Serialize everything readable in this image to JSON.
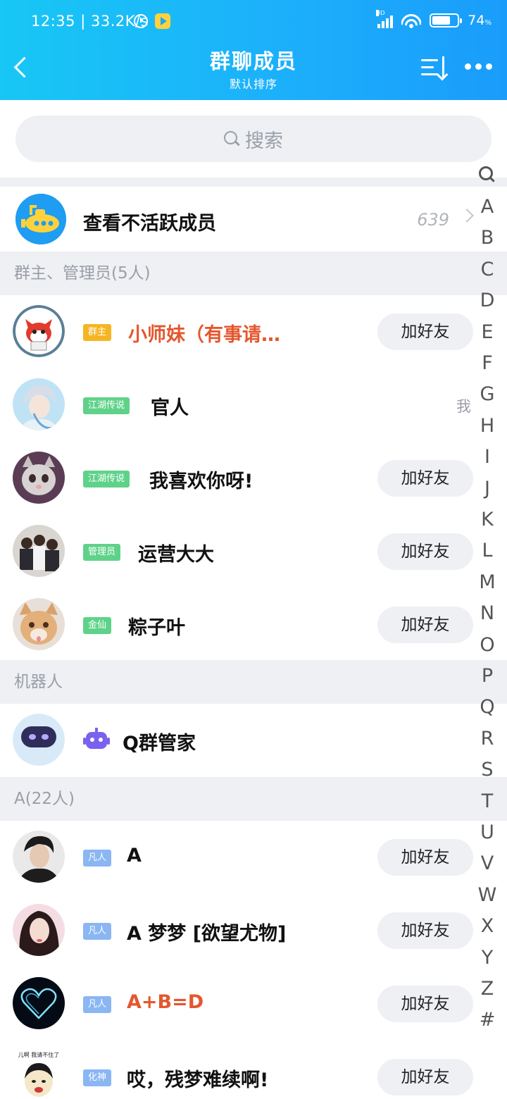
{
  "status_bar": {
    "time": "12:35",
    "network_speed": "33.2K/s",
    "hd_label": "HD",
    "battery_percent": "74",
    "battery_unit": "%",
    "battery_level": 0.74
  },
  "nav": {
    "title": "群聊成员",
    "subtitle": "默认排序"
  },
  "search": {
    "placeholder": "搜索"
  },
  "inactive": {
    "label": "查看不活跃成员",
    "count": "639"
  },
  "sections": {
    "admins_header": "群主、管理员(5人)",
    "robots_header": "机器人",
    "a_header": "A(22人)"
  },
  "admins": [
    {
      "badge": "群主",
      "badge_color": "#f5b523",
      "name": "小师妹（有事请…",
      "name_color": "#e4572e",
      "action": "加好友"
    },
    {
      "badge": "江湖传说",
      "badge_color": "#5fd28a",
      "name": "官人",
      "name_color": "#111111",
      "me_label": "我"
    },
    {
      "badge": "江湖传说",
      "badge_color": "#5fd28a",
      "name": "我喜欢你呀!",
      "name_color": "#111111",
      "action": "加好友"
    },
    {
      "badge": "管理员",
      "badge_color": "#5fd28a",
      "name": "运营大大",
      "name_color": "#111111",
      "action": "加好友"
    },
    {
      "badge": "金仙",
      "badge_color": "#5fd28a",
      "name": "粽子叶",
      "name_color": "#111111",
      "action": "加好友"
    }
  ],
  "robots": [
    {
      "name": "Q群管家",
      "icon": "robot-icon",
      "icon_color": "#7b61f0"
    }
  ],
  "a_members": [
    {
      "badge": "凡人",
      "badge_color": "#8ab6f3",
      "name": "A",
      "name_color": "#111111",
      "action": "加好友"
    },
    {
      "badge": "凡人",
      "badge_color": "#8ab6f3",
      "name": "A 梦梦 [欲望尤物]",
      "name_color": "#111111",
      "action": "加好友"
    },
    {
      "badge": "凡人",
      "badge_color": "#8ab6f3",
      "name": "A+B=D",
      "name_color": "#e4572e",
      "action": "加好友"
    },
    {
      "badge": "化神",
      "badge_color": "#8ab6f3",
      "name": "哎，残梦难续啊!",
      "name_color": "#111111",
      "action": "加好友",
      "avatar_caption": "儿啊 我请不住了"
    }
  ],
  "alphabet_index": [
    "A",
    "B",
    "C",
    "D",
    "E",
    "F",
    "G",
    "H",
    "I",
    "J",
    "K",
    "L",
    "M",
    "N",
    "O",
    "P",
    "Q",
    "R",
    "S",
    "T",
    "U",
    "V",
    "W",
    "X",
    "Y",
    "Z",
    "#"
  ]
}
